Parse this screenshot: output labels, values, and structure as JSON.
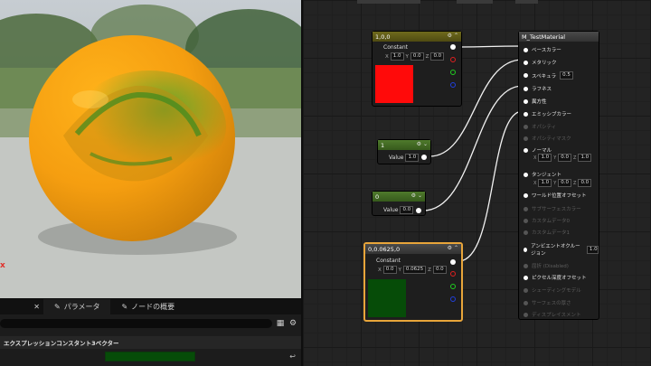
{
  "viewport": {
    "axis_label": "x"
  },
  "details_panel": {
    "tabs": [
      {
        "label": "パラメータ",
        "icon": "pencil-icon"
      },
      {
        "label": "ノードの概要",
        "icon": "pencil-icon"
      }
    ],
    "section_title": "エクスプレッションコンスタント3ベクター",
    "color_value": "#064c08"
  },
  "graph": {
    "node_red": {
      "title": "1,0,0",
      "caption": "Constant",
      "fields": [
        {
          "axis": "X",
          "value": "1.0"
        },
        {
          "axis": "Y",
          "value": "0.0"
        },
        {
          "axis": "Z",
          "value": "0.0"
        }
      ],
      "preview_color": "#ff0a0a"
    },
    "node_one": {
      "title": "1",
      "value_label": "Value",
      "value": "1.0"
    },
    "node_zero": {
      "title": "0",
      "value_label": "Value",
      "value": "0.0"
    },
    "node_green": {
      "title": "0,0.0625,0",
      "caption": "Constant",
      "fields": [
        {
          "axis": "X",
          "value": "0.0"
        },
        {
          "axis": "Y",
          "value": "0.0625"
        },
        {
          "axis": "Z",
          "value": "0.0"
        }
      ],
      "preview_color": "#064c08"
    },
    "material": {
      "title": "M_TestMaterial",
      "inputs": [
        {
          "label": "ベースカラー",
          "enabled": true
        },
        {
          "label": "メタリック",
          "enabled": true
        },
        {
          "label": "スペキュラ",
          "enabled": true,
          "value": "0.5"
        },
        {
          "label": "ラフネス",
          "enabled": true
        },
        {
          "label": "異方性",
          "enabled": true
        },
        {
          "label": "エミッシブカラー",
          "enabled": true
        },
        {
          "label": "オパシティ",
          "enabled": false
        },
        {
          "label": "オパシティマスク",
          "enabled": false
        },
        {
          "label": "ノーマル",
          "enabled": true,
          "fields": [
            "1.0",
            "0.0",
            "1.0"
          ]
        },
        {
          "label": "タンジェント",
          "enabled": true,
          "fields": [
            "1.0",
            "0.0",
            "0.0"
          ]
        },
        {
          "label": "ワールド位置オフセット",
          "enabled": true
        },
        {
          "label": "サブサーフェスカラー",
          "enabled": false
        },
        {
          "label": "カスタムデータ0",
          "enabled": false
        },
        {
          "label": "カスタムデータ1",
          "enabled": false
        },
        {
          "label": "アンビエントオクルージョン",
          "enabled": true,
          "value": "1.0"
        },
        {
          "label": "屈折 (Disabled)",
          "enabled": false
        },
        {
          "label": "ピクセル深度オフセット",
          "enabled": true
        },
        {
          "label": "シェーディングモデル",
          "enabled": false
        },
        {
          "label": "サーフェスの厚さ",
          "enabled": false
        },
        {
          "label": "ディスプレイスメント",
          "enabled": false
        }
      ]
    }
  }
}
